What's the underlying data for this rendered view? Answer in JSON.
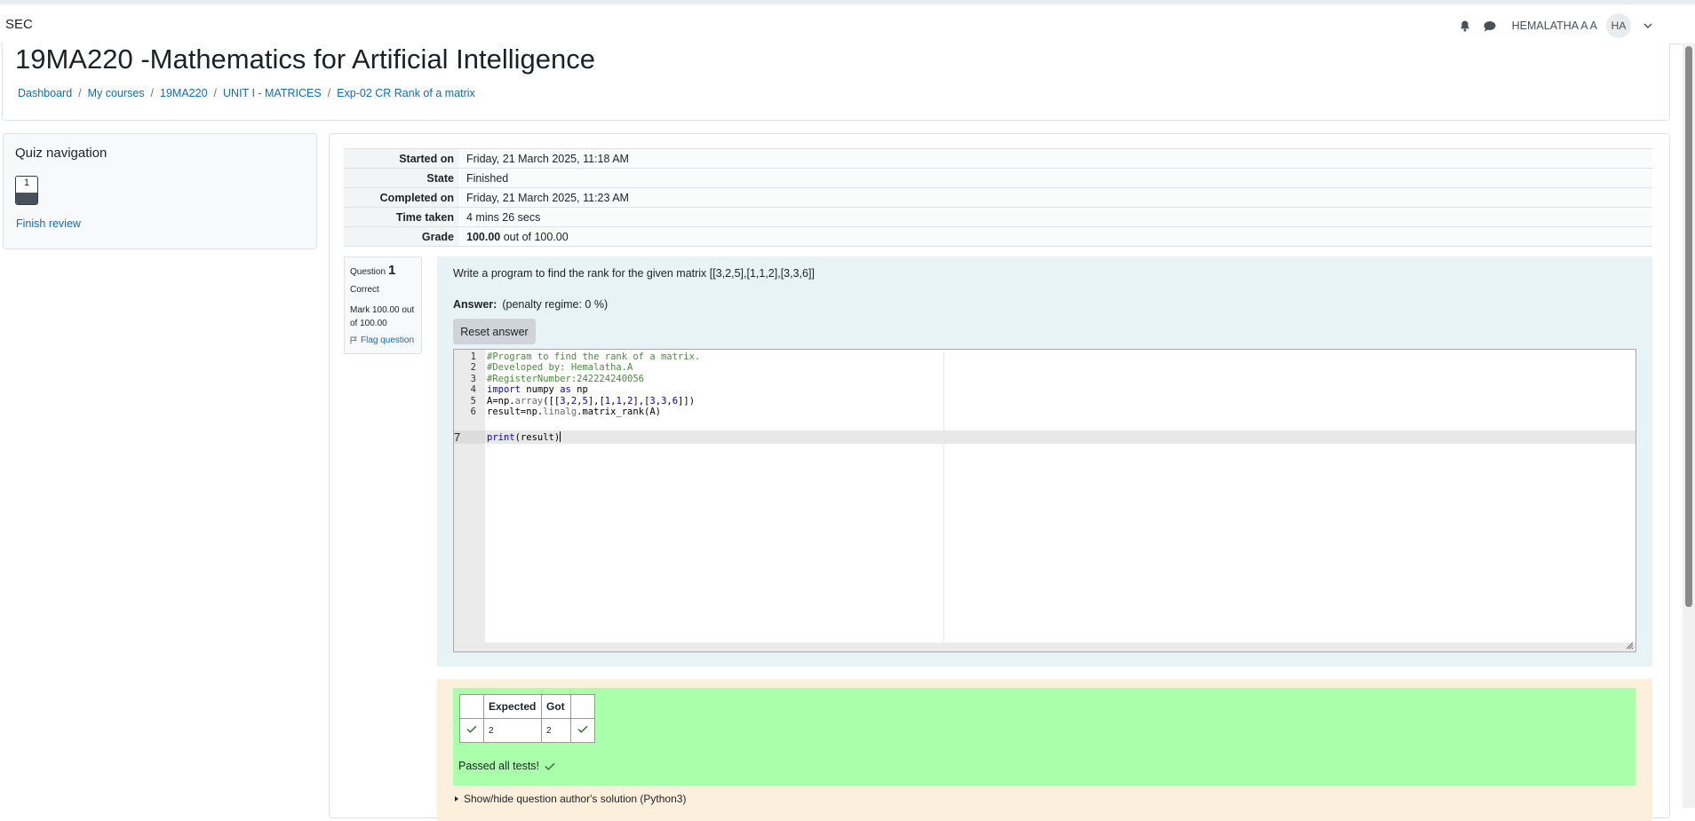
{
  "navbar": {
    "site_name": "SEC",
    "user_name": "HEMALATHA A A",
    "avatar_initials": "HA"
  },
  "header": {
    "title": "19MA220 -Mathematics for Artificial Intelligence",
    "breadcrumb": [
      "Dashboard",
      "My courses",
      "19MA220",
      "UNIT I - MATRICES",
      "Exp-02 CR Rank of a matrix"
    ]
  },
  "quiz_nav": {
    "title": "Quiz navigation",
    "question_button": "1",
    "finish_review": "Finish review"
  },
  "summary": {
    "started_on_label": "Started on",
    "started_on": "Friday, 21 March 2025, 11:18 AM",
    "state_label": "State",
    "state": "Finished",
    "completed_on_label": "Completed on",
    "completed_on": "Friday, 21 March 2025, 11:23 AM",
    "time_taken_label": "Time taken",
    "time_taken": "4 mins 26 secs",
    "grade_label": "Grade",
    "grade_value": "100.00",
    "grade_rest": "out of 100.00"
  },
  "question": {
    "label": "Question",
    "number": "1",
    "state": "Correct",
    "mark": "Mark 100.00 out of 100.00",
    "flag": "Flag question",
    "text": "Write a program to find the rank for the given matrix [[3,2,5],[1,1,2],[3,3,6]]",
    "answer_label": "Answer:",
    "penalty": "(penalty regime: 0 %)",
    "reset_button": "Reset answer",
    "line_numbers": [
      "1",
      "2",
      "3",
      "4",
      "5",
      "6",
      "7"
    ],
    "code": {
      "l1": "#Program to find the rank of a matrix.",
      "l2": "#Developed by: Hemalatha.A",
      "l3": "#RegisterNumber:242224240056",
      "l4_kw1": "import",
      "l4_mid": " numpy ",
      "l4_kw2": "as",
      "l4_end": " np",
      "l5_a": "A=np.",
      "l5_b": "array",
      "l5_c": "([[",
      "l5_d": "3",
      "l5_e": ",",
      "l5_f": "2",
      "l5_g": ",",
      "l5_h": "5",
      "l5_i": "],[",
      "l5_j": "1",
      "l5_k": ",",
      "l5_l": "1",
      "l5_m": ",",
      "l5_n": "2",
      "l5_o": "],[",
      "l5_p": "3",
      "l5_q": ",",
      "l5_r": "3",
      "l5_s": ",",
      "l5_t": "6",
      "l5_u": "]])",
      "l6_a": "result=np.",
      "l6_b": "linalg",
      "l6_c": ".matrix_rank(A)",
      "l7_kw": "print",
      "l7_rest": "(result)"
    }
  },
  "results": {
    "headers": [
      "",
      "Expected",
      "Got",
      ""
    ],
    "row": {
      "expected": "2",
      "got": "2"
    },
    "passed_text": "Passed all tests!",
    "show_hide": "Show/hide question author's solution (Python3)"
  },
  "colors": {
    "link": "#0f6cbf",
    "pass_green": "#aaffaa",
    "formulation_bg": "#e7f3f5",
    "outcome_bg": "#fcefdc"
  }
}
